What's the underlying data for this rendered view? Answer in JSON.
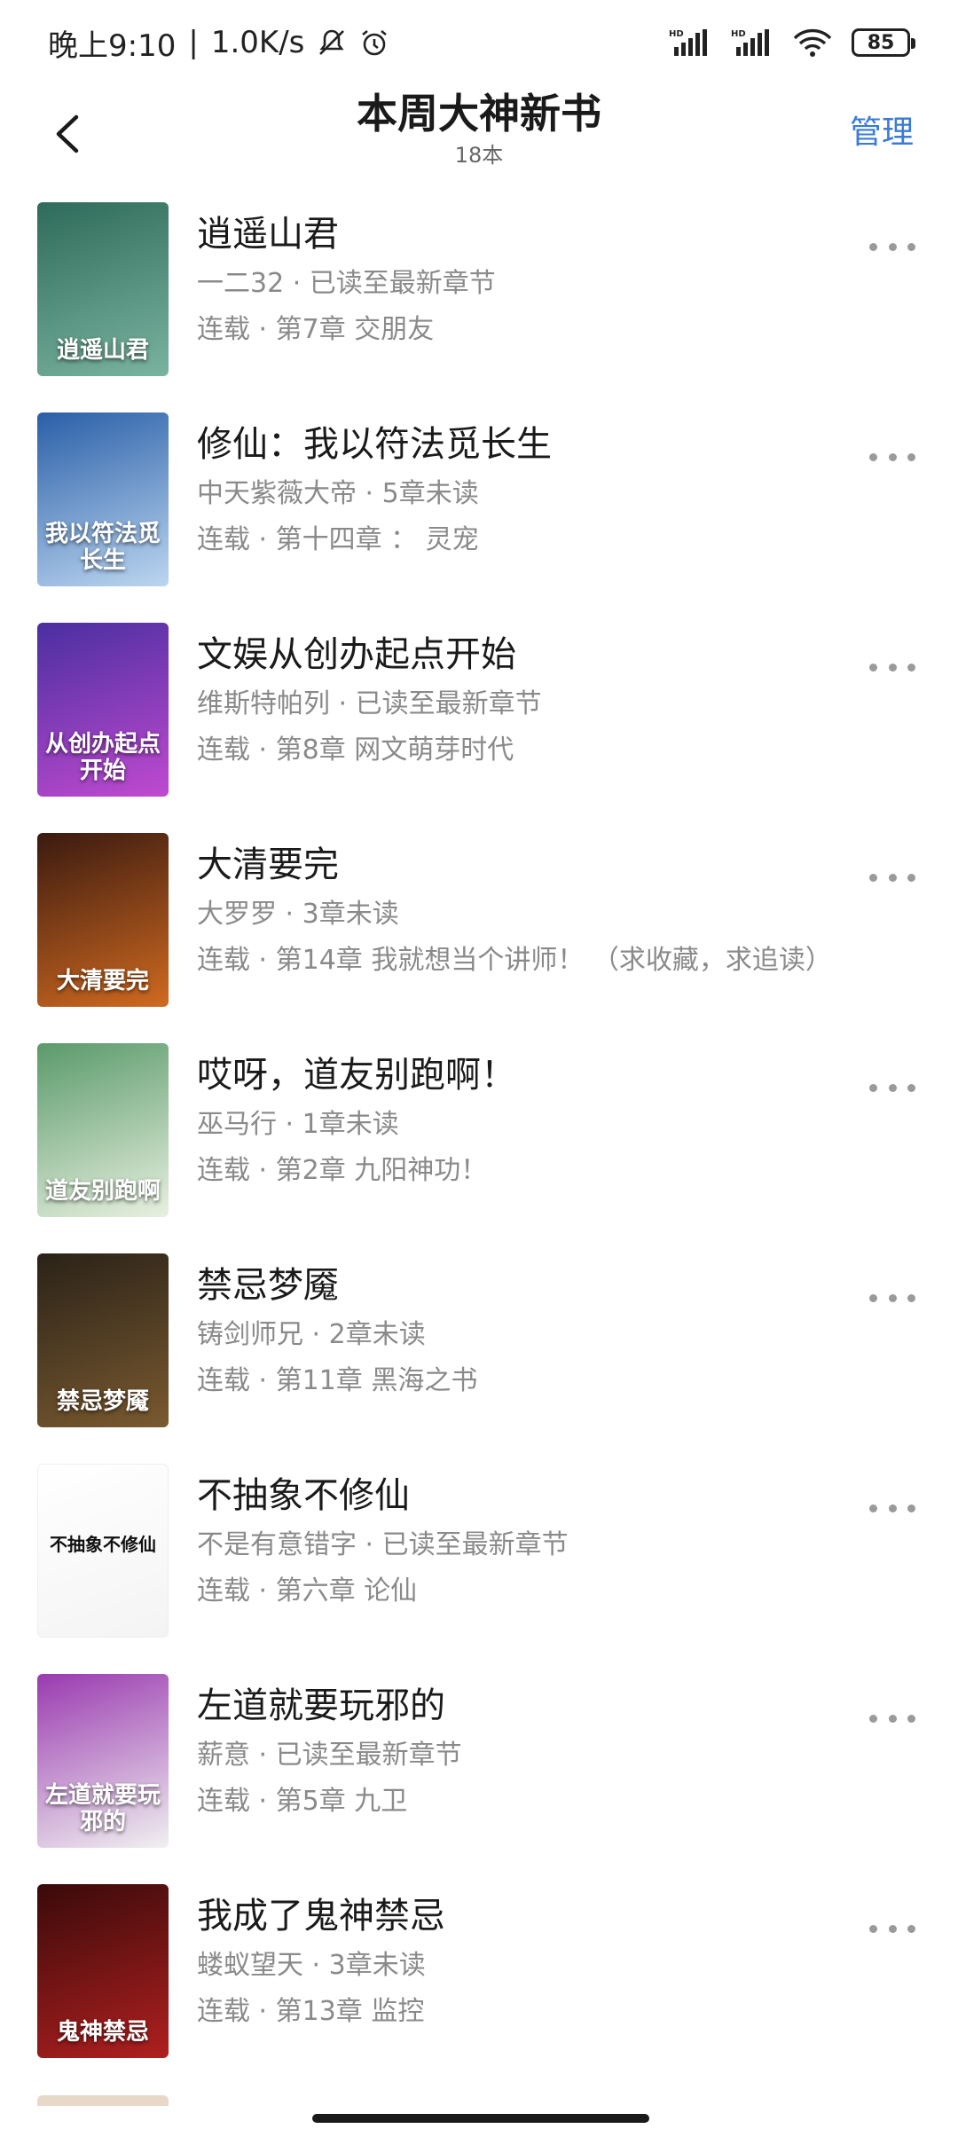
{
  "status_bar": {
    "time": "晚上9:10",
    "speed": "1.0K/s",
    "battery": "85",
    "net1": "HD",
    "net2": "HD"
  },
  "header": {
    "title": "本周大神新书",
    "subtitle": "18本",
    "manage_label": "管理"
  },
  "books": [
    {
      "title": "逍遥山君",
      "author": "一二32",
      "progress": "已读至最新章节",
      "status": "连载",
      "chapter": "第7章 交朋友",
      "cover_text": "逍遥山君",
      "cover_colors": [
        "#2f6b5a",
        "#7ab3a0"
      ]
    },
    {
      "title": "修仙：我以符法觅长生",
      "author": "中天紫薇大帝",
      "progress": "5章未读",
      "status": "连载",
      "chapter": "第十四章 ： 灵宠",
      "cover_text": "我以符法觅长生",
      "cover_colors": [
        "#2a5fa8",
        "#bcd6f0"
      ]
    },
    {
      "title": "文娱从创办起点开始",
      "author": "维斯特帕列",
      "progress": "已读至最新章节",
      "status": "连载",
      "chapter": "第8章 网文萌芽时代",
      "cover_text": "从创办起点开始",
      "cover_colors": [
        "#4a2fa0",
        "#c04ad0"
      ]
    },
    {
      "title": "大清要完",
      "author": "大罗罗",
      "progress": "3章未读",
      "status": "连载",
      "chapter": "第14章 我就想当个讲师！ （求收藏，求追读）",
      "cover_text": "大清要完",
      "cover_colors": [
        "#3a1a10",
        "#d06a20"
      ]
    },
    {
      "title": "哎呀，道友别跑啊！",
      "author": "巫马行",
      "progress": "1章未读",
      "status": "连载",
      "chapter": "第2章 九阳神功！",
      "cover_text": "道友别跑啊",
      "cover_colors": [
        "#5a9a6a",
        "#e8f0e0"
      ]
    },
    {
      "title": "禁忌梦魇",
      "author": "铸剑师兄",
      "progress": "2章未读",
      "status": "连载",
      "chapter": "第11章 黑海之书",
      "cover_text": "禁忌梦魇",
      "cover_colors": [
        "#2a2218",
        "#7a5a30"
      ]
    },
    {
      "title": "不抽象不修仙",
      "author": "不是有意错字",
      "progress": "已读至最新章节",
      "status": "连载",
      "chapter": "第六章 论仙",
      "cover_text": "不抽象不修仙",
      "cover_colors": [
        "#ffffff",
        "#f4f4f4"
      ]
    },
    {
      "title": "左道就要玩邪的",
      "author": "薪意",
      "progress": "已读至最新章节",
      "status": "连载",
      "chapter": "第5章 九卫",
      "cover_text": "左道就要玩邪的",
      "cover_colors": [
        "#9a3ab0",
        "#f0f0f0"
      ]
    },
    {
      "title": "我成了鬼神禁忌",
      "author": "蝼蚁望天",
      "progress": "3章未读",
      "status": "连载",
      "chapter": "第13章 监控",
      "cover_text": "鬼神禁忌",
      "cover_colors": [
        "#3a0a0a",
        "#b02020"
      ]
    }
  ]
}
